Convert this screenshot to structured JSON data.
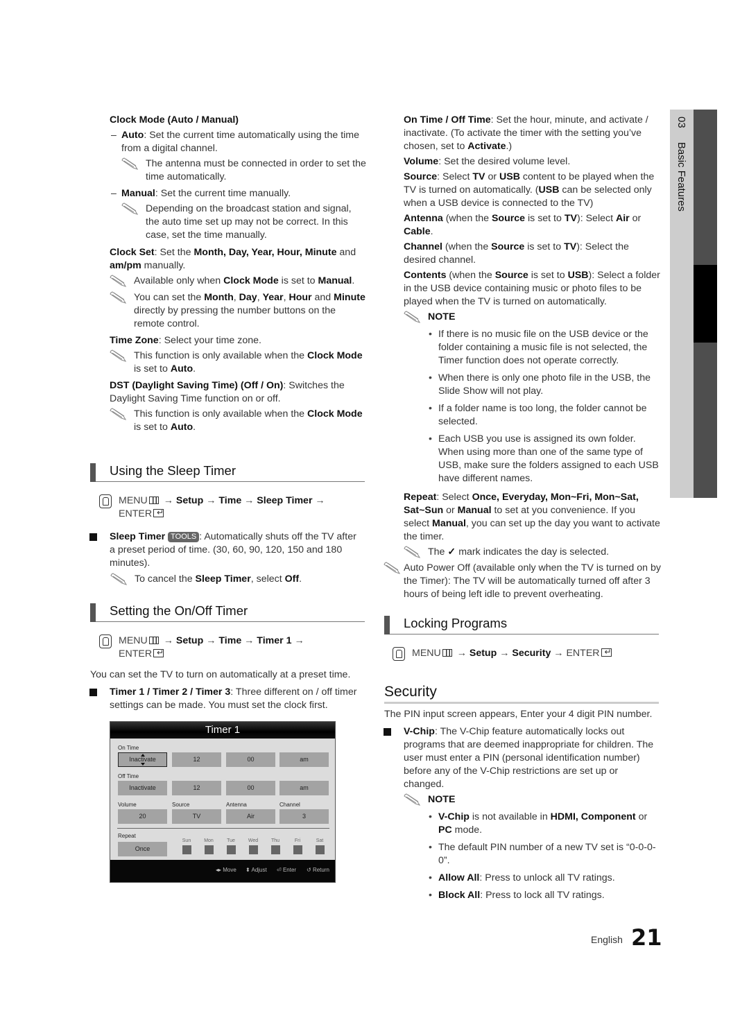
{
  "side_tab": {
    "chapter_number": "03",
    "chapter_title": "Basic Features"
  },
  "left": {
    "clock_mode_title": "Clock Mode (Auto / Manual)",
    "auto_label": "Auto",
    "auto_text": ": Set the current time automatically using the time from a digital channel.",
    "auto_note": "The antenna must be connected in order to set the time automatically.",
    "manual_label": "Manual",
    "manual_text": ": Set the current time manually.",
    "manual_note": "Depending on the broadcast station and signal, the auto time set up may not be correct. In this case, set the time manually.",
    "clock_set_label": "Clock Set",
    "clock_set_text_1": ": Set the ",
    "clock_set_bold": "Month, Day, Year, Hour, Minute",
    "clock_set_text_2": " and ",
    "clock_set_bold_2": "am/pm",
    "clock_set_text_3": " manually.",
    "note_avail_1": "Available only when ",
    "note_avail_bold": "Clock Mode",
    "note_avail_2": " is set to ",
    "note_avail_bold_2": "Manual",
    "note_avail_3": ".",
    "note_set_1": "You can set the ",
    "note_set_month": "Month",
    "note_set_day": "Day",
    "note_set_year": "Year",
    "note_set_hour": "Hour",
    "note_set_and": " and ",
    "note_set_minute": "Minute",
    "note_set_rest": " directly by pressing the number buttons on the remote control.",
    "time_zone_label": "Time Zone",
    "time_zone_text": ": Select your time zone.",
    "tz_note_1": "This function is only available when the ",
    "tz_note_bold": "Clock Mode",
    "tz_note_2": " is set to ",
    "tz_note_bold_2": "Auto",
    "tz_note_3": ".",
    "dst_label": "DST (Daylight Saving Time) (Off / On)",
    "dst_text": ": Switches the Daylight Saving Time function on or off.",
    "dst_note_1": "This function is only available when the ",
    "dst_note_bold": "Clock Mode",
    "dst_note_2": " is set to ",
    "dst_note_bold_2": "Auto",
    "dst_note_3": "."
  },
  "sleep_timer": {
    "heading": "Using the Sleep Timer",
    "menu": "MENU",
    "path": [
      "Setup",
      "Time",
      "Sleep Timer"
    ],
    "enter": "ENTER",
    "item_label": "Sleep Timer",
    "tools_badge": "TOOLS",
    "item_text": ": Automatically shuts off the TV after a preset period of time. (30, 60, 90, 120, 150 and 180 minutes).",
    "note_1": "To cancel the ",
    "note_bold": "Sleep Timer",
    "note_2": ", select ",
    "note_bold_2": "Off",
    "note_3": "."
  },
  "onoff_timer": {
    "heading": "Setting the On/Off Timer",
    "menu": "MENU",
    "path": [
      "Setup",
      "Time",
      "Timer 1"
    ],
    "enter": "ENTER",
    "intro": "You can set the TV to turn on automatically at a preset time.",
    "item_label": "Timer 1 / Timer 2 / Timer 3",
    "item_text": ": Three different on / off timer settings can be made. You must set the clock first."
  },
  "osd": {
    "title": "Timer 1",
    "on_time_label": "On Time",
    "on_time": [
      "Inactivate",
      "12",
      "00",
      "am"
    ],
    "off_time_label": "Off Time",
    "off_time": [
      "Inactivate",
      "12",
      "00",
      "am"
    ],
    "volume_label": "Volume",
    "volume": "20",
    "source_label": "Source",
    "source": "TV",
    "antenna_label": "Antenna",
    "antenna": "Air",
    "channel_label": "Channel",
    "channel": "3",
    "repeat_label": "Repeat",
    "repeat": "Once",
    "days": [
      "Sun",
      "Mon",
      "Tue",
      "Wed",
      "Thu",
      "Fri",
      "Sat"
    ],
    "footer": {
      "move": "Move",
      "adjust": "Adjust",
      "enter": "Enter",
      "return": "Return"
    }
  },
  "right": {
    "on_off_label": "On Time / Off Time",
    "on_off_text_1": ": Set the hour, minute, and activate / inactivate. (To activate the timer with the setting you’ve chosen, set to ",
    "on_off_bold": "Activate",
    "on_off_text_2": ".)",
    "volume_label": "Volume",
    "volume_text": ": Set the desired volume level.",
    "source_label": "Source",
    "source_text_1": ": Select ",
    "source_tv": "TV",
    "source_or": " or ",
    "source_usb": "USB",
    "source_text_2": " content to be played when the TV is turned on automatically. (",
    "source_usb_2": "USB",
    "source_text_3": " can be selected only when a USB device is connected to the TV)",
    "antenna_label": "Antenna",
    "antenna_text_1": " (when the ",
    "antenna_source": "Source",
    "antenna_text_2": " is set to ",
    "antenna_tv": "TV",
    "antenna_text_3": "): Select ",
    "antenna_air": "Air",
    "antenna_text_4": " or ",
    "antenna_cable": "Cable",
    "antenna_text_5": ".",
    "channel_label": "Channel",
    "channel_text_1": " (when the ",
    "channel_source": "Source",
    "channel_text_2": " is set to ",
    "channel_tv": "TV",
    "channel_text_3": "): Select the desired channel.",
    "contents_label": "Contents",
    "contents_text_1": " (when the ",
    "contents_source": "Source",
    "contents_text_2": " is set to ",
    "contents_usb": "USB",
    "contents_text_3": "): Select a folder in the USB device containing music or photo files to be played when the TV is turned on automatically.",
    "note_label": "NOTE",
    "notes": [
      "If there is no music file on the USB device or the folder containing a music file is not selected, the Timer function does not operate correctly.",
      "When there is only one photo file in the USB, the Slide Show will not play.",
      "If a folder name is too long, the folder cannot be selected.",
      "Each USB you use is assigned its own folder. When using more than one of the same type of USB, make sure the folders assigned to each USB have different names."
    ],
    "repeat_label": "Repeat",
    "repeat_text_1": ": Select ",
    "repeat_bold": "Once, Everyday, Mon~Fri, Mon~Sat, Sat~Sun",
    "repeat_text_2": " or ",
    "repeat_manual": "Manual",
    "repeat_text_3": " to set at you convenience. If you select ",
    "repeat_manual_2": "Manual",
    "repeat_text_4": ", you can set up the day you want to activate the timer.",
    "check_note_1": "The ",
    "check_note_2": " mark indicates the day is selected.",
    "auto_power_off": "Auto Power Off (available only when the TV is turned on by the Timer): The TV will be automatically turned off after 3 hours of being left idle to prevent overheating."
  },
  "locking": {
    "heading": "Locking Programs",
    "menu": "MENU",
    "path": [
      "Setup",
      "Security"
    ],
    "enter": "ENTER"
  },
  "security": {
    "heading": "Security",
    "intro": "The PIN input screen appears, Enter your 4 digit PIN number.",
    "vchip_label": "V-Chip",
    "vchip_text": ": The V-Chip feature automatically locks out programs that are deemed inappropriate for children. The user must enter a PIN (personal identification number) before any of the V-Chip restrictions are set up or changed.",
    "note_label": "NOTE",
    "n1_bold": "V-Chip",
    "n1_text_1": " is not available in ",
    "n1_bold_2": "HDMI, Component",
    "n1_text_2": " or ",
    "n1_bold_3": "PC",
    "n1_text_3": " mode.",
    "n2": "The default PIN number of a new TV set is “0-0-0-0”.",
    "n3_bold": "Allow All",
    "n3_text": ": Press to unlock all TV ratings.",
    "n4_bold": "Block All",
    "n4_text": ": Press to lock all TV ratings."
  },
  "footer": {
    "language": "English",
    "page_number": "21"
  }
}
